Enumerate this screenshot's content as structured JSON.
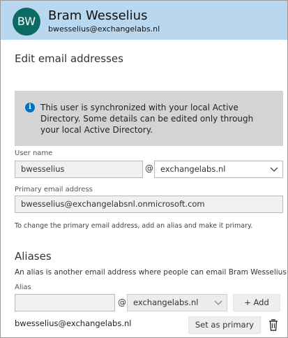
{
  "header": {
    "initials": "BW",
    "name": "Bram Wesselius",
    "email": "bwesselius@exchangelabs.nl",
    "bg_color": "#b9d7ee",
    "avatar_color": "#0b6a63"
  },
  "title": "Edit email addresses",
  "info": {
    "icon": "info-icon",
    "text": "This user is synchronized with your local Active Directory. Some details can be edited only through your local Active Directory."
  },
  "username": {
    "label": "User name",
    "value": "bwesselius",
    "at": "@",
    "domain": "exchangelabs.nl"
  },
  "primary": {
    "label": "Primary email address",
    "value": "bwesselius@exchangelabsnl.onmicrosoft.com",
    "hint": "To change the primary email address, add an alias and make it primary."
  },
  "aliases": {
    "title": "Aliases",
    "description": "An alias is another email address where people can email Bram Wesselius",
    "alias_label": "Alias",
    "alias_value": "",
    "at": "@",
    "domain": "exchangelabs.nl",
    "add_label": "+ Add",
    "existing": "bwesselius@exchangelabs.nl",
    "set_primary_label": "Set as primary",
    "delete_icon": "trash-icon"
  }
}
